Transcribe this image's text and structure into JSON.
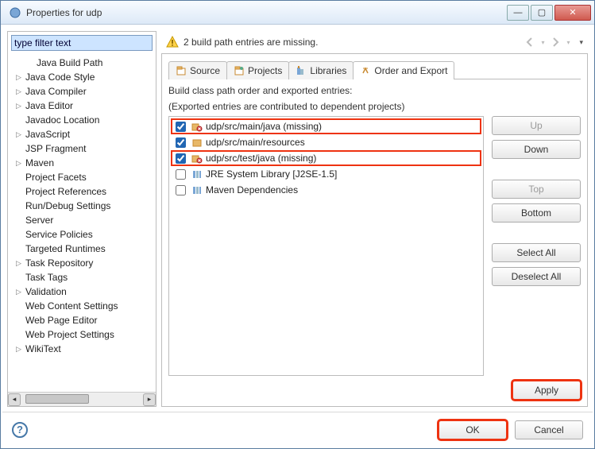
{
  "window": {
    "title": "Properties for udp"
  },
  "filter": {
    "text": "type filter text"
  },
  "tree": {
    "items": [
      {
        "label": "Java Build Path",
        "expand": "",
        "indent": true,
        "sel": true
      },
      {
        "label": "Java Code Style",
        "expand": "▷"
      },
      {
        "label": "Java Compiler",
        "expand": "▷"
      },
      {
        "label": "Java Editor",
        "expand": "▷"
      },
      {
        "label": "Javadoc Location",
        "expand": ""
      },
      {
        "label": "JavaScript",
        "expand": "▷"
      },
      {
        "label": "JSP Fragment",
        "expand": ""
      },
      {
        "label": "Maven",
        "expand": "▷"
      },
      {
        "label": "Project Facets",
        "expand": ""
      },
      {
        "label": "Project References",
        "expand": ""
      },
      {
        "label": "Run/Debug Settings",
        "expand": ""
      },
      {
        "label": "Server",
        "expand": ""
      },
      {
        "label": "Service Policies",
        "expand": ""
      },
      {
        "label": "Targeted Runtimes",
        "expand": ""
      },
      {
        "label": "Task Repository",
        "expand": "▷"
      },
      {
        "label": "Task Tags",
        "expand": ""
      },
      {
        "label": "Validation",
        "expand": "▷"
      },
      {
        "label": "Web Content Settings",
        "expand": ""
      },
      {
        "label": "Web Page Editor",
        "expand": ""
      },
      {
        "label": "Web Project Settings",
        "expand": ""
      },
      {
        "label": "WikiText",
        "expand": "▷"
      }
    ]
  },
  "warn": {
    "text": "2 build path entries are missing."
  },
  "tabs": {
    "items": [
      {
        "label": "Source"
      },
      {
        "label": "Projects"
      },
      {
        "label": "Libraries"
      },
      {
        "label": "Order and Export"
      }
    ],
    "active": 3
  },
  "desc": {
    "line1": "Build class path order and exported entries:",
    "line2": "(Exported entries are contributed to dependent projects)"
  },
  "entries": [
    {
      "label": "udp/src/main/java (missing)",
      "checked": true,
      "missing": true,
      "highlight": true,
      "icon": "package-missing"
    },
    {
      "label": "udp/src/main/resources",
      "checked": true,
      "missing": false,
      "highlight": false,
      "icon": "package"
    },
    {
      "label": "udp/src/test/java (missing)",
      "checked": true,
      "missing": true,
      "highlight": true,
      "icon": "package-missing"
    },
    {
      "label": "JRE System Library [J2SE-1.5]",
      "checked": false,
      "missing": false,
      "highlight": false,
      "icon": "library"
    },
    {
      "label": "Maven Dependencies",
      "checked": false,
      "missing": false,
      "highlight": false,
      "icon": "library"
    }
  ],
  "sidebuttons": {
    "up": "Up",
    "down": "Down",
    "top": "Top",
    "bottom": "Bottom",
    "selectall": "Select All",
    "deselectall": "Deselect All"
  },
  "apply": "Apply",
  "ok": "OK",
  "cancel": "Cancel"
}
